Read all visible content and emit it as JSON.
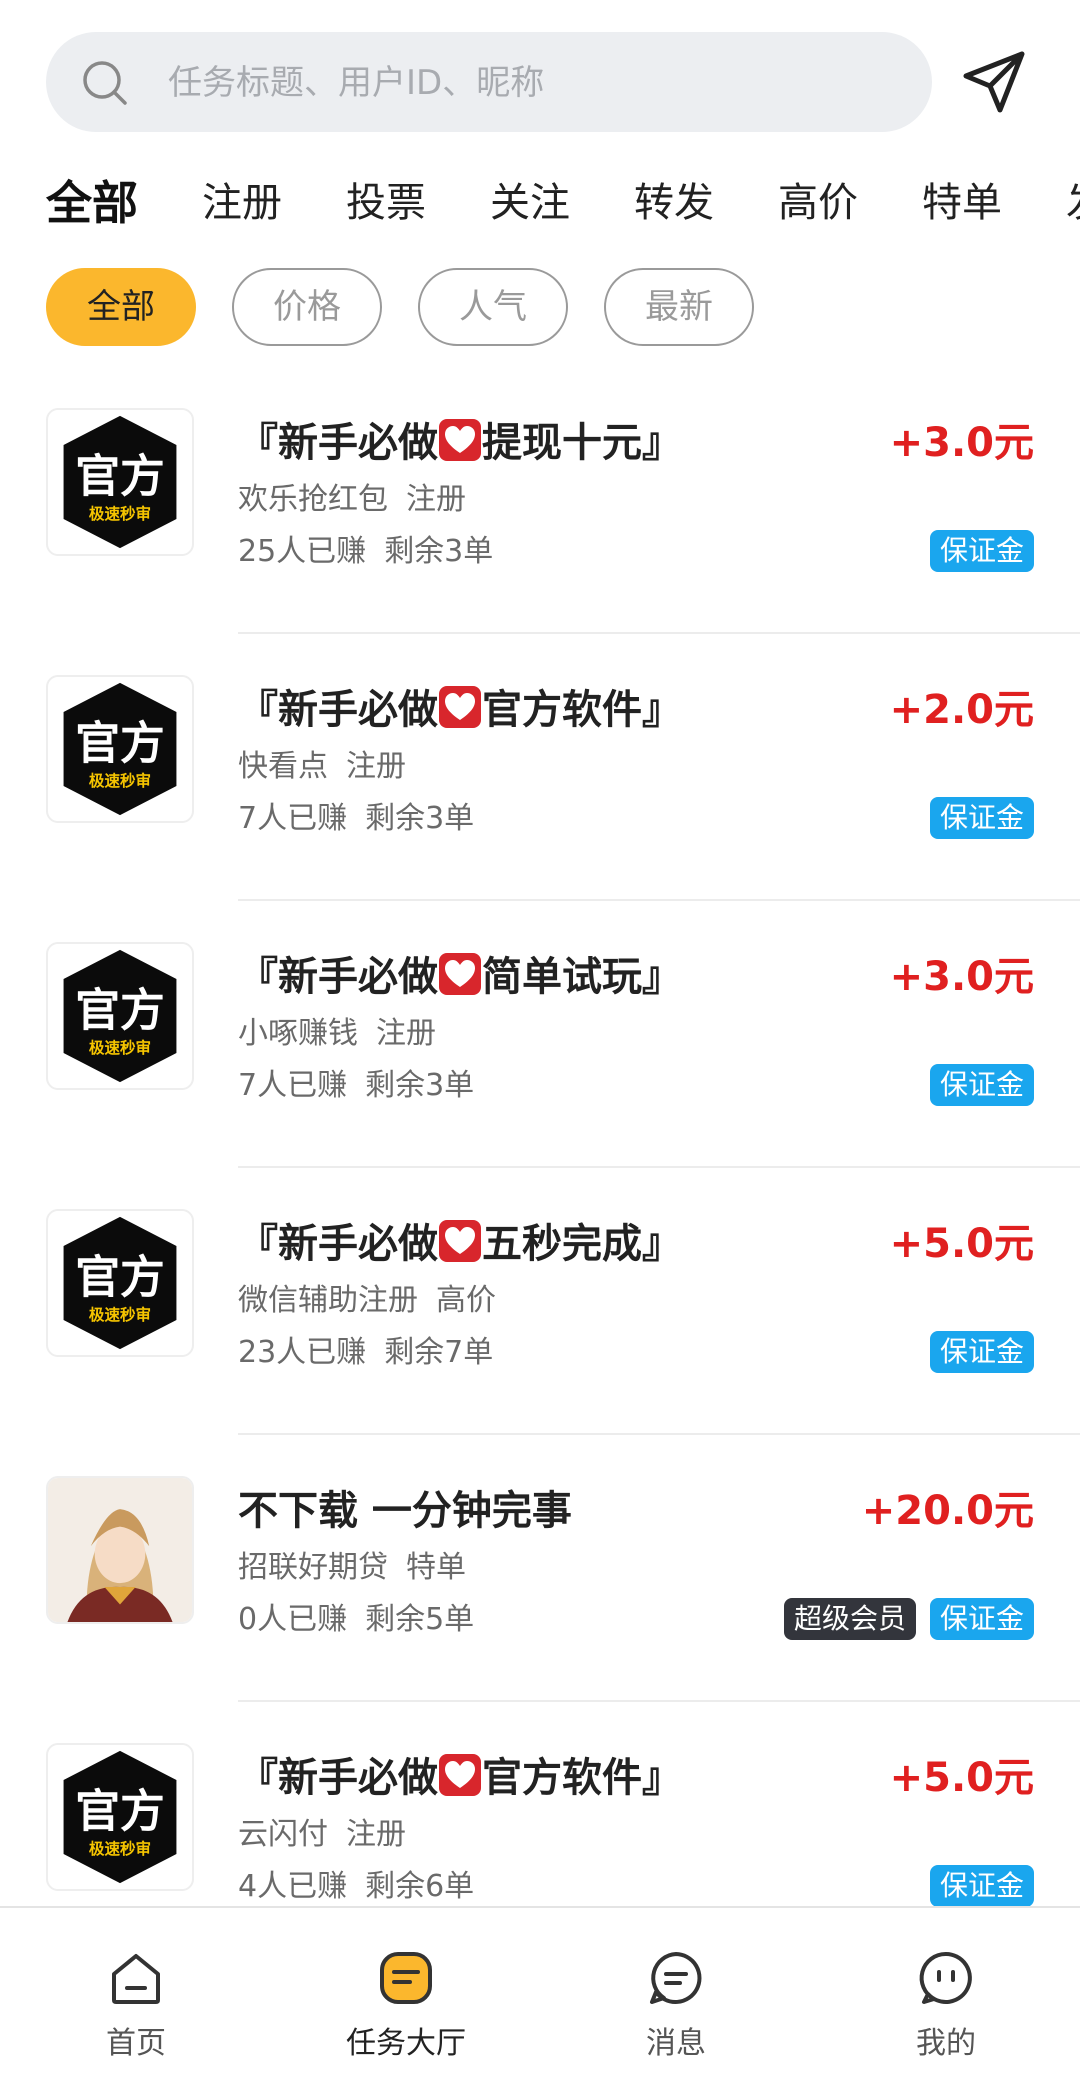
{
  "search": {
    "placeholder": "任务标题、用户ID、昵称"
  },
  "tabs": [
    {
      "label": "全部",
      "active": true
    },
    {
      "label": "注册"
    },
    {
      "label": "投票"
    },
    {
      "label": "关注"
    },
    {
      "label": "转发"
    },
    {
      "label": "高价"
    },
    {
      "label": "特单"
    },
    {
      "label": "发"
    }
  ],
  "filters": [
    {
      "label": "全部",
      "active": true
    },
    {
      "label": "价格"
    },
    {
      "label": "人气"
    },
    {
      "label": "最新"
    }
  ],
  "official_logo": {
    "line1": "官方",
    "line2": "极速秒审"
  },
  "tasks": [
    {
      "title_pre": "『新手必做",
      "title_post": "提现十元』",
      "heart": true,
      "price": "+3.0元",
      "app": "欢乐抢红包",
      "tag": "注册",
      "earned": "25人已赚",
      "left": "剩余3单",
      "badges": [
        "保证金"
      ]
    },
    {
      "title_pre": "『新手必做",
      "title_post": "官方软件』",
      "heart": true,
      "price": "+2.0元",
      "app": "快看点",
      "tag": "注册",
      "earned": "7人已赚",
      "left": "剩余3单",
      "badges": [
        "保证金"
      ]
    },
    {
      "title_pre": "『新手必做",
      "title_post": "简单试玩』",
      "heart": true,
      "price": "+3.0元",
      "app": "小啄赚钱",
      "tag": "注册",
      "earned": "7人已赚",
      "left": "剩余3单",
      "badges": [
        "保证金"
      ]
    },
    {
      "title_pre": "『新手必做",
      "title_post": "五秒完成』",
      "heart": true,
      "price": "+5.0元",
      "app": "微信辅助注册",
      "tag": "高价",
      "earned": "23人已赚",
      "left": "剩余7单",
      "badges": [
        "保证金"
      ]
    },
    {
      "title_pre": "不下载 一分钟完事",
      "title_post": "",
      "heart": false,
      "price": "+20.0元",
      "app": "招联好期贷",
      "tag": "特单",
      "earned": "0人已赚",
      "left": "剩余5单",
      "badges": [
        "超级会员",
        "保证金"
      ]
    },
    {
      "title_pre": "『新手必做",
      "title_post": "官方软件』",
      "heart": true,
      "price": "+5.0元",
      "app": "云闪付",
      "tag": "注册",
      "earned": "4人已赚",
      "left": "剩余6单",
      "badges": [
        "保证金"
      ]
    }
  ],
  "nav": [
    {
      "label": "首页",
      "icon": "home-icon"
    },
    {
      "label": "任务大厅",
      "icon": "task-hall-icon",
      "active": true
    },
    {
      "label": "消息",
      "icon": "message-icon"
    },
    {
      "label": "我的",
      "icon": "profile-icon"
    }
  ],
  "colors": {
    "accent": "#fbb72d",
    "price": "#e02020",
    "deposit": "#1aa6ee",
    "vip": "#33353c"
  }
}
